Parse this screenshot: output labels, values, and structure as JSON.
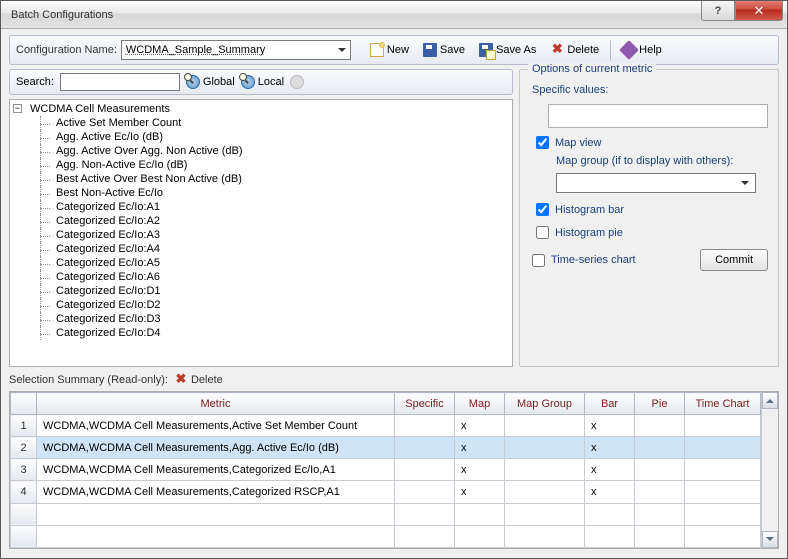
{
  "window": {
    "title": "Batch Configurations"
  },
  "toolbar": {
    "config_label": "Configuration Name:",
    "config_value": "WCDMA_Sample_Summary",
    "new": "New",
    "save": "Save",
    "save_as": "Save As",
    "delete": "Delete",
    "help": "Help"
  },
  "search": {
    "label": "Search:",
    "value": "",
    "global": "Global",
    "local": "Local"
  },
  "tree": {
    "root": "WCDMA Cell Measurements",
    "items": [
      "Active Set Member Count",
      "Agg. Active Ec/Io (dB)",
      "Agg. Active Over Agg. Non Active (dB)",
      "Agg. Non-Active Ec/Io (dB)",
      "Best Active Over Best Non Active (dB)",
      "Best Non-Active Ec/Io",
      "Categorized Ec/Io:A1",
      "Categorized Ec/Io:A2",
      "Categorized Ec/Io:A3",
      "Categorized Ec/Io:A4",
      "Categorized Ec/Io:A5",
      "Categorized Ec/Io:A6",
      "Categorized Ec/Io:D1",
      "Categorized Ec/Io:D2",
      "Categorized Ec/Io:D3",
      "Categorized Ec/Io:D4"
    ]
  },
  "options": {
    "title": "Options of current metric",
    "specific_values": "Specific values:",
    "specific_value": "",
    "map_view": "Map view",
    "map_group_label": "Map group (if to display with others):",
    "map_group_value": "",
    "histogram_bar": "Histogram bar",
    "histogram_pie": "Histogram pie",
    "timeseries": "Time-series chart",
    "commit": "Commit",
    "checked": {
      "map_view": true,
      "histogram_bar": true,
      "histogram_pie": false,
      "timeseries": false
    }
  },
  "summary": {
    "label": "Selection Summary (Read-only):",
    "delete": "Delete"
  },
  "grid": {
    "headers": [
      "Metric",
      "Specific",
      "Map",
      "Map Group",
      "Bar",
      "Pie",
      "Time Chart"
    ],
    "rows": [
      {
        "n": "1",
        "metric": "WCDMA,WCDMA Cell Measurements,Active Set Member Count",
        "specific": "",
        "map": "x",
        "mapgroup": "",
        "bar": "x",
        "pie": "",
        "time": ""
      },
      {
        "n": "2",
        "metric": "WCDMA,WCDMA Cell Measurements,Agg. Active Ec/Io (dB)",
        "specific": "",
        "map": "x",
        "mapgroup": "",
        "bar": "x",
        "pie": "",
        "time": "",
        "selected": true
      },
      {
        "n": "3",
        "metric": "WCDMA,WCDMA Cell Measurements,Categorized Ec/Io,A1",
        "specific": "",
        "map": "x",
        "mapgroup": "",
        "bar": "x",
        "pie": "",
        "time": ""
      },
      {
        "n": "4",
        "metric": "WCDMA,WCDMA Cell Measurements,Categorized RSCP,A1",
        "specific": "",
        "map": "x",
        "mapgroup": "",
        "bar": "x",
        "pie": "",
        "time": ""
      }
    ]
  }
}
